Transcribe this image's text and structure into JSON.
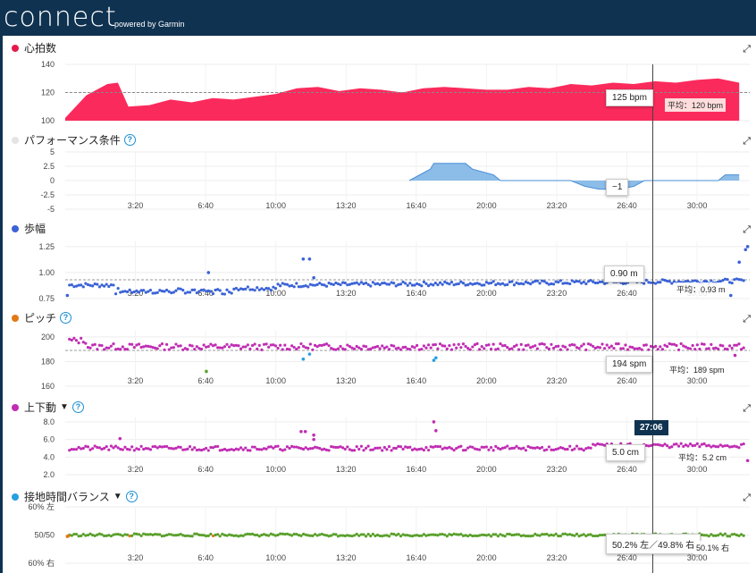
{
  "header": {
    "logo": "connect",
    "powered": "powered by Garmin"
  },
  "x_ticks": [
    "3:20",
    "6:40",
    "10:00",
    "13:20",
    "16:40",
    "20:00",
    "23:20",
    "26:40",
    "30:00"
  ],
  "cursor_time": "27:06",
  "colors": {
    "heart": "#fb2a5c",
    "perf": "#7fb5e6",
    "stride": "#3b63d6",
    "cadence": "#c02db3",
    "vo": "#c02db3",
    "gct_good": "#5aa02c",
    "gct_low": "#e07a16",
    "outlier": "#26a0e0"
  },
  "panels": {
    "heart": {
      "title": "心拍数",
      "value": "125 bpm",
      "avg": "平均：120 bpm",
      "y_ticks": [
        "140",
        "120",
        "100"
      ]
    },
    "perf": {
      "title": "パフォーマンス条件",
      "value": "−1",
      "y_ticks": [
        "5",
        "2.5",
        "0",
        "-2.5",
        "-5"
      ]
    },
    "stride": {
      "title": "歩幅",
      "value": "0.90 m",
      "avg": "平均：0.93 m",
      "y_ticks": [
        "1.25",
        "1.00",
        "0.75"
      ]
    },
    "cadence": {
      "title": "ピッチ",
      "value": "194 spm",
      "avg": "平均：189 spm",
      "y_ticks": [
        "200",
        "180",
        "160"
      ]
    },
    "vo": {
      "title": "上下動",
      "value": "5.0 cm",
      "avg": "平均：5.2 cm",
      "y_ticks": [
        "8.0",
        "6.0",
        "4.0",
        "2.0"
      ]
    },
    "gct": {
      "title": "接地時間バランス",
      "value": "50.2% 左／49.8% 右",
      "avg": "50.1% 右",
      "y_ticks": [
        "60% 左",
        "50/50",
        "60% 右"
      ]
    }
  },
  "chart_data": [
    {
      "type": "area",
      "title": "心拍数",
      "ylim": [
        100,
        140
      ],
      "avg": 120,
      "cursor": {
        "x": "27:06",
        "value": 125
      },
      "x": [
        "0:00",
        "1:00",
        "2:00",
        "2:30",
        "3:00",
        "4:00",
        "5:00",
        "6:00",
        "7:00",
        "8:00",
        "9:00",
        "10:00",
        "11:00",
        "12:00",
        "13:00",
        "14:00",
        "15:00",
        "16:00",
        "17:00",
        "18:00",
        "19:00",
        "20:00",
        "21:00",
        "22:00",
        "23:00",
        "24:00",
        "25:00",
        "26:00",
        "27:00",
        "28:00",
        "29:00",
        "30:00",
        "31:00",
        "32:00"
      ],
      "values": [
        102,
        118,
        126,
        127,
        110,
        111,
        115,
        113,
        116,
        115,
        117,
        119,
        123,
        124,
        121,
        123,
        122,
        120,
        123,
        124,
        123,
        122,
        122,
        124,
        123,
        126,
        125,
        127,
        126,
        128,
        127,
        129,
        130,
        127
      ]
    },
    {
      "type": "area",
      "title": "パフォーマンス条件",
      "ylim": [
        -5,
        5
      ],
      "cursor": {
        "x": "27:06",
        "value": -1
      },
      "x": [
        "16:20",
        "17:20",
        "17:30",
        "19:00",
        "19:20",
        "20:20",
        "20:40",
        "24:00",
        "24:40",
        "25:20",
        "26:20",
        "27:00",
        "27:30",
        "28:40",
        "30:00",
        "31:00",
        "31:20",
        "32:00"
      ],
      "values": [
        0,
        2,
        3,
        3,
        2,
        1,
        0,
        0,
        -1,
        -1.5,
        -1.5,
        -1,
        0,
        0,
        0,
        0,
        1,
        1
      ]
    },
    {
      "type": "scatter",
      "title": "歩幅",
      "ylim": [
        0.75,
        1.3
      ],
      "avg": 0.93,
      "cursor": {
        "x": "27:06",
        "value": 0.9
      },
      "typical_range": [
        0.8,
        0.92
      ]
    },
    {
      "type": "scatter",
      "title": "ピッチ",
      "ylim": [
        160,
        205
      ],
      "avg": 189,
      "cursor": {
        "x": "27:06",
        "value": 194
      },
      "typical_range": [
        188,
        196
      ]
    },
    {
      "type": "scatter",
      "title": "上下動",
      "ylim": [
        2,
        8.5
      ],
      "avg": 5.2,
      "cursor": {
        "x": "27:06",
        "value": 5.0
      },
      "typical_range": [
        4.8,
        5.6
      ]
    },
    {
      "type": "scatter",
      "title": "接地時間バランス",
      "ylim": [
        -10,
        10
      ],
      "avg": 0.1,
      "cursor": {
        "x": "27:06",
        "value": "50.2% 左／49.8% 右"
      }
    }
  ]
}
